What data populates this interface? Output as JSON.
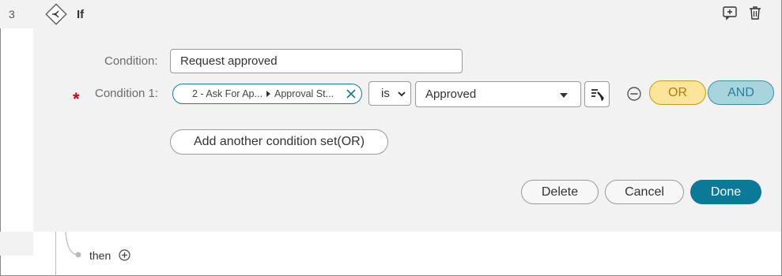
{
  "step": {
    "number": "3",
    "type_label": "If"
  },
  "toolbar": {
    "add_comment_icon": "add-comment-icon",
    "delete_icon": "trash-icon"
  },
  "condition": {
    "label": "Condition:",
    "name_value": "Request approved"
  },
  "condition_1": {
    "required_mark": "*",
    "label": "Condition 1:",
    "token_step": "2 - Ask For Ap...",
    "token_field": "Approval St...",
    "operator": "is",
    "value": "Approved"
  },
  "logic": {
    "or_label": "OR",
    "and_label": "AND"
  },
  "add_set_label": "Add another condition set(OR)",
  "footer": {
    "delete_label": "Delete",
    "cancel_label": "Cancel",
    "done_label": "Done"
  },
  "branch": {
    "then_label": "then"
  },
  "colors": {
    "accent": "#0a7a98",
    "or_fill": "#fbe59a",
    "and_fill": "#a8d4de",
    "required": "#d0021b",
    "panel_bg": "#f2f2f2"
  }
}
